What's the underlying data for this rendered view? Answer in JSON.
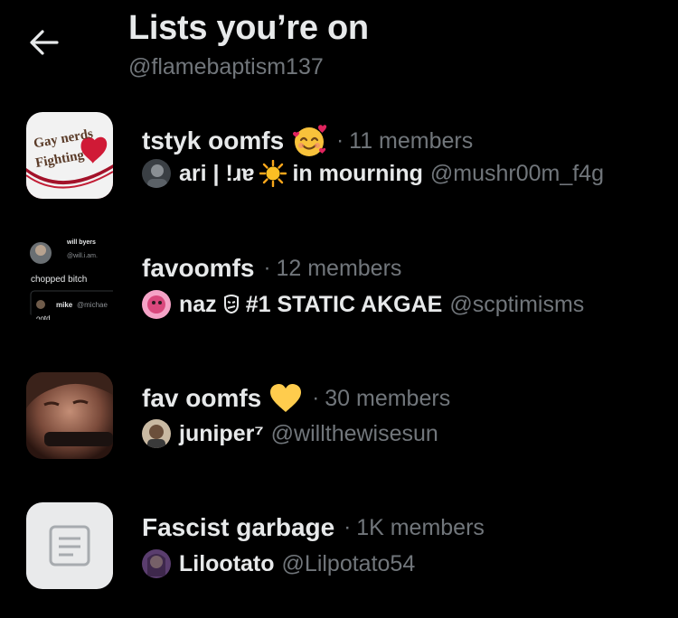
{
  "header": {
    "title": "Lists you’re on",
    "handle": "@flamebaptism137"
  },
  "lists": [
    {
      "name": "tstyk oomfs",
      "name_emoji": "smiling-face-with-hearts",
      "separator": "·",
      "members": "11 members",
      "thumb_text_1": "Gay nerds",
      "thumb_text_2": "Fighting",
      "owner_name_a": "ari | !ɹɐ",
      "owner_name_b": "in mourning",
      "owner_emoji": "sun-burst",
      "owner_handle": "@mushr00m_f4g"
    },
    {
      "name": "favoomfs",
      "separator": "·",
      "members": "12 members",
      "thumb_user": "will byers",
      "thumb_user_handle": "@will.i.am.",
      "thumb_text": "chopped bitch",
      "thumb_quote_user": "mike",
      "thumb_quote_handle": "@michae",
      "thumb_quote_text": "ootd",
      "owner_name_a": "naz",
      "owner_name_b": "#1 STATIC AKGAE",
      "owner_handle": "@scptimisms"
    },
    {
      "name": "fav oomfs",
      "name_emoji": "yellow-heart",
      "separator": "·",
      "members": "30 members",
      "owner_name": "juniper⁷",
      "owner_handle": "@willthewisesun"
    },
    {
      "name": "Fascist garbage",
      "separator": "·",
      "members": "1K members",
      "owner_name": "Lilootato",
      "owner_handle": "@Lilpotato54"
    }
  ]
}
